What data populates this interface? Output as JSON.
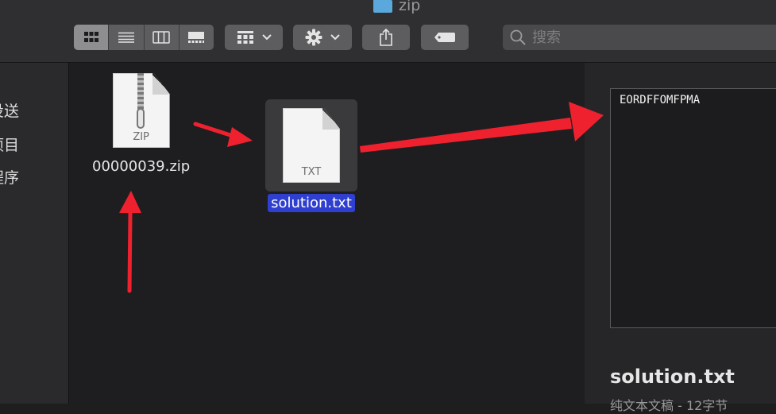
{
  "window": {
    "title": "zip"
  },
  "search": {
    "placeholder": "搜索"
  },
  "sidebar": {
    "items": [
      "投送",
      "项目",
      "程序"
    ]
  },
  "files": [
    {
      "name": "00000039.zip",
      "type": "ZIP"
    },
    {
      "name": "solution.txt",
      "type": "TXT",
      "selected": true
    }
  ],
  "preview": {
    "content": "EORDFFOMFPMA",
    "filename": "solution.txt",
    "info": "纯文本文稿 - 12字节"
  },
  "colors": {
    "annotation": "#f0212f",
    "selection": "#2f3fcf",
    "folder": "#5aa8dc"
  }
}
